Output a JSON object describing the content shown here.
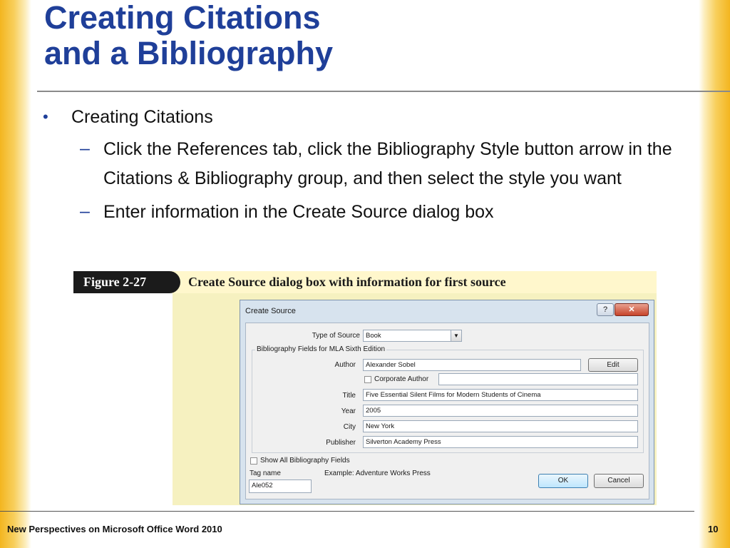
{
  "slide": {
    "title_line1": "Creating Citations",
    "title_line2": "and a Bibliography",
    "bullets": [
      {
        "level": 1,
        "marker": "•",
        "text": "Creating Citations"
      },
      {
        "level": 2,
        "marker": "–",
        "text": "Click the References tab, click the Bibliography Style button arrow in the Citations & Bibliography group, and then select the style you want"
      },
      {
        "level": 2,
        "marker": "–",
        "text": "Enter information in the Create Source dialog box"
      }
    ],
    "footer_left": "New Perspectives on Microsoft Office Word 2010",
    "page_number": "10"
  },
  "figure": {
    "label": "Figure 2-27",
    "caption": "Create Source dialog box with information for first source"
  },
  "dialog": {
    "title": "Create Source",
    "help_label": "?",
    "close_label": "✕",
    "type_of_source_label": "Type of Source",
    "type_of_source_value": "Book",
    "group_title": "Bibliography Fields for MLA Sixth Edition",
    "author_label": "Author",
    "author_value": "Alexander Sobel",
    "edit_button": "Edit",
    "corporate_author_label": "Corporate Author",
    "title_label": "Title",
    "title_value": "Five Essential Silent Films for Modern Students of Cinema",
    "year_label": "Year",
    "year_value": "2005",
    "city_label": "City",
    "city_value": "New York",
    "publisher_label": "Publisher",
    "publisher_value": "Silverton Academy Press",
    "show_all_label": "Show All Bibliography Fields",
    "tag_name_label": "Tag name",
    "example_text": "Example: Adventure Works Press",
    "tag_value": "Ale052",
    "ok_button": "OK",
    "cancel_button": "Cancel"
  },
  "colors": {
    "title_blue": "#1f3f99",
    "accent_gold": "#f3b51f"
  }
}
